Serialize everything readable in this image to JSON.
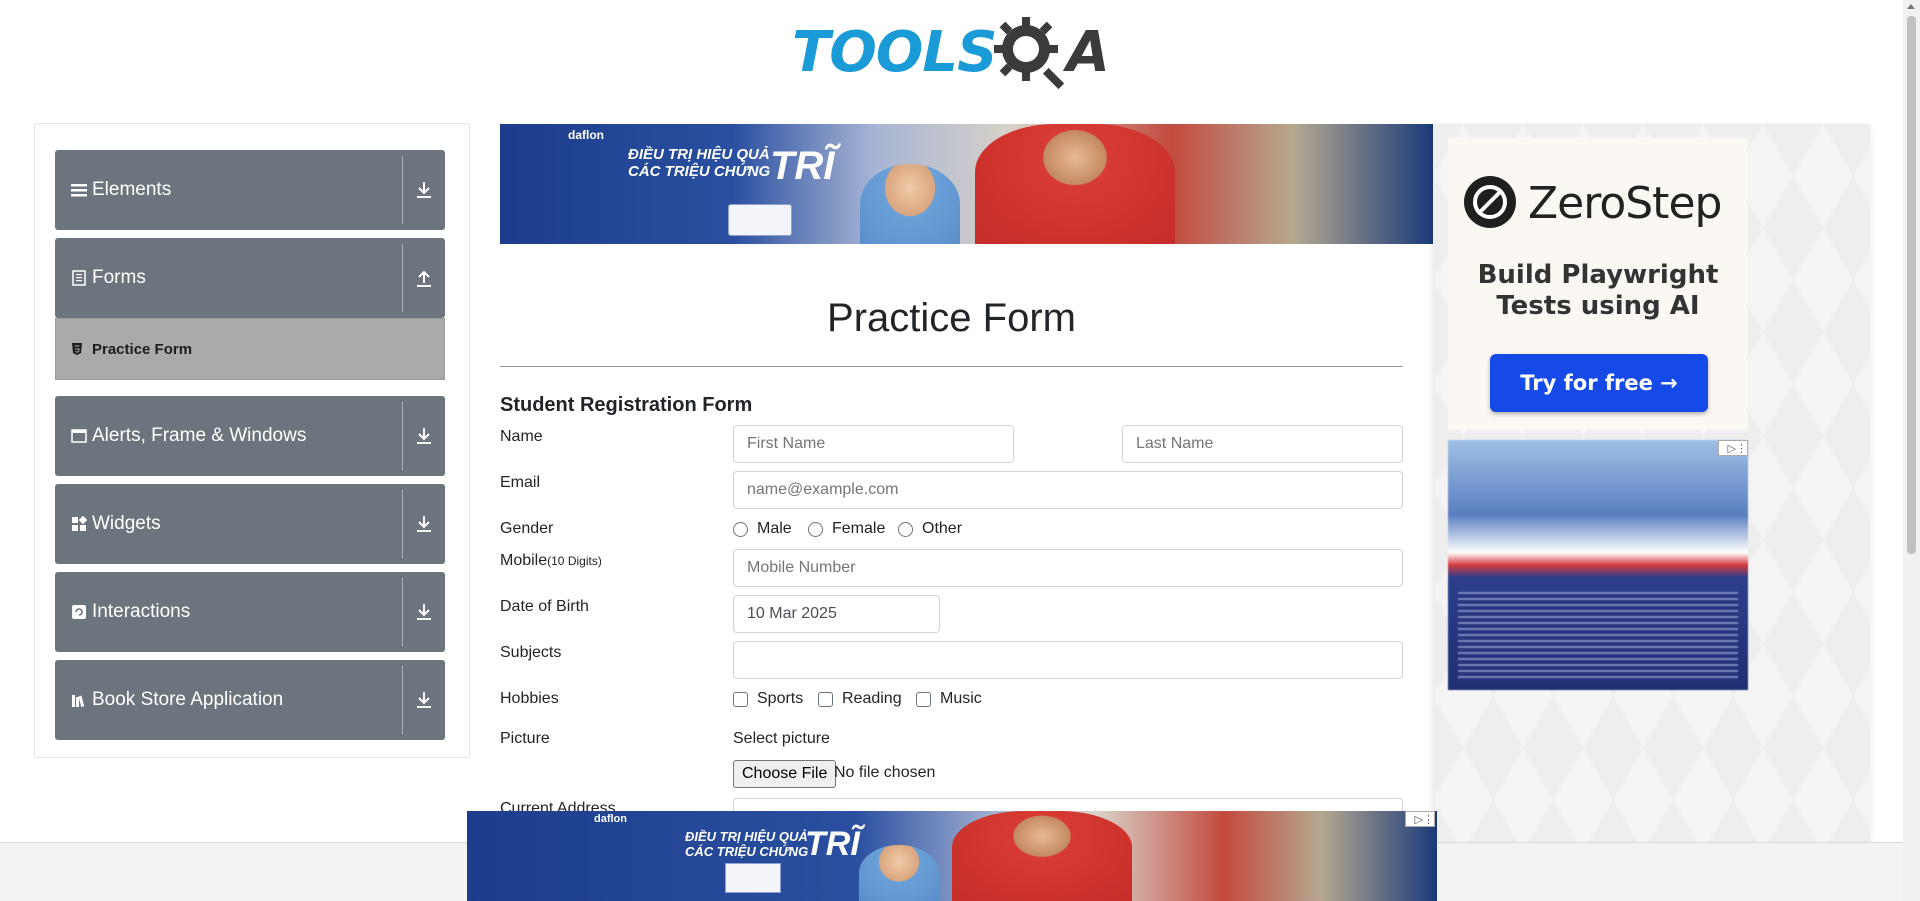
{
  "logo": {
    "part1": "TOOLS",
    "part2": "A"
  },
  "sidebar": {
    "groups": [
      {
        "label": "Elements",
        "icon": "menu-icon",
        "arrow": "down"
      },
      {
        "label": "Forms",
        "icon": "form-icon",
        "arrow": "up"
      },
      {
        "label": "Alerts, Frame & Windows",
        "icon": "window-icon",
        "arrow": "down"
      },
      {
        "label": "Widgets",
        "icon": "widgets-icon",
        "arrow": "down"
      },
      {
        "label": "Interactions",
        "icon": "interactions-icon",
        "arrow": "down"
      },
      {
        "label": "Book Store Application",
        "icon": "books-icon",
        "arrow": "down"
      }
    ],
    "active_item": {
      "label": "Practice Form",
      "icon": "html5-icon"
    }
  },
  "banner_top": {
    "brand": "daflon",
    "line1": "ĐIỀU TRỊ HIỆU QUẢ",
    "line2": "CÁC TRIỆU CHỨNG",
    "big": "TRĨ"
  },
  "main": {
    "page_title": "Practice Form",
    "form_title": "Student Registration Form",
    "name_label": "Name",
    "first_name_placeholder": "First Name",
    "last_name_placeholder": "Last Name",
    "email_label": "Email",
    "email_placeholder": "name@example.com",
    "gender_label": "Gender",
    "gender_options": [
      "Male",
      "Female",
      "Other"
    ],
    "mobile_label": "Mobile",
    "mobile_hint": "(10 Digits)",
    "mobile_placeholder": "Mobile Number",
    "dob_label": "Date of Birth",
    "dob_value": "10 Mar 2025",
    "subjects_label": "Subjects",
    "hobbies_label": "Hobbies",
    "hobby_options": [
      "Sports",
      "Reading",
      "Music"
    ],
    "picture_label": "Picture",
    "select_picture": "Select picture",
    "choose_file": "Choose File",
    "no_file": "No file chosen",
    "address_label": "Current Address"
  },
  "right_ad": {
    "brand": "ZeroStep",
    "tag_line1": "Build Playwright",
    "tag_line2": "Tests using AI",
    "cta": "Try for free →"
  },
  "banner_bottom": {
    "brand": "daflon",
    "line1": "ĐIỀU TRỊ HIỆU QUẢ",
    "line2": "CÁC TRIỆU CHỨNG",
    "big": "TRĨ"
  },
  "colors": {
    "sidebar_group": "#6c757d",
    "active_item": "#aaaaaa",
    "logo_blue": "#1a9bd7",
    "cta_blue": "#1549e8"
  }
}
